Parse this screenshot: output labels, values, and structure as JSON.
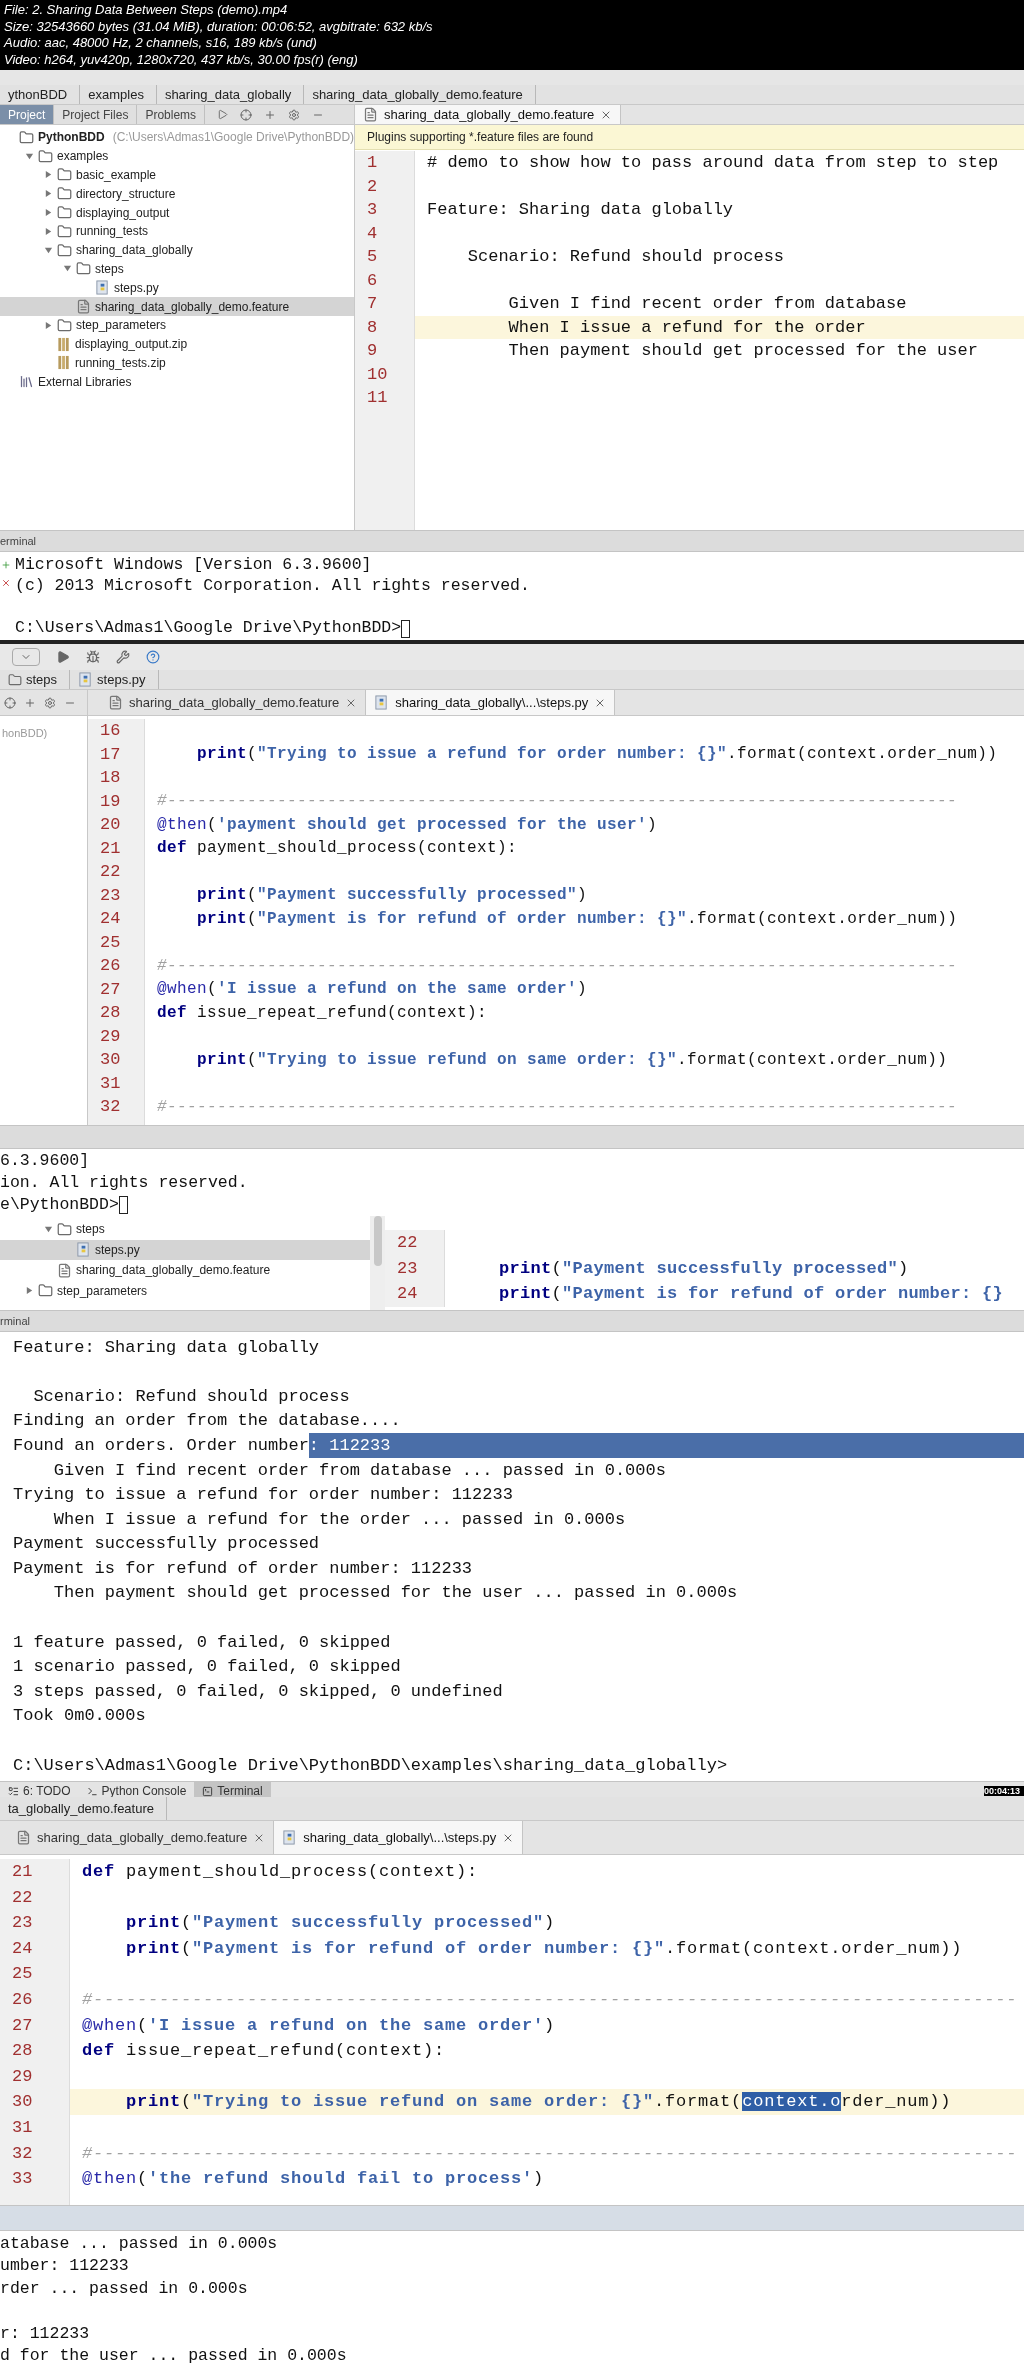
{
  "file_info": [
    "File: 2. Sharing Data Between Steps (demo).mp4",
    "Size: 32543660 bytes (31.04 MiB), duration: 00:06:52, avgbitrate: 632 kb/s",
    "Audio: aac, 48000 Hz, 2 channels, s16, 189 kb/s (und)",
    "Video: h264, yuv420p, 1280x720, 437 kb/s, 30.00 fps(r) (eng)"
  ],
  "frame_1": {
    "breadcrumbs": [
      "ythonBDD",
      "examples",
      "sharing_data_globally",
      "sharing_data_globally_demo.feature"
    ],
    "panel_tabs": [
      {
        "label": "Project",
        "selected": true
      },
      {
        "label": "Project Files",
        "selected": false
      },
      {
        "label": "Problems",
        "selected": false
      }
    ],
    "tree": [
      {
        "label": "PythonBDD",
        "path": "(C:\\Users\\Admas1\\Google Drive\\PythonBDD)",
        "kind": "folder",
        "selected": false,
        "children": [
          {
            "label": "examples",
            "kind": "folder",
            "expanded": true,
            "selected": false,
            "children": [
              {
                "label": "basic_example",
                "kind": "folder",
                "expanded": false,
                "selected": false
              },
              {
                "label": "directory_structure",
                "kind": "folder",
                "expanded": false,
                "selected": false
              },
              {
                "label": "displaying_output",
                "kind": "folder",
                "expanded": false,
                "selected": false
              },
              {
                "label": "running_tests",
                "kind": "folder",
                "expanded": false,
                "selected": false
              },
              {
                "label": "sharing_data_globally",
                "kind": "folder",
                "expanded": true,
                "selected": false,
                "children": [
                  {
                    "label": "steps",
                    "kind": "folder",
                    "expanded": true,
                    "selected": false,
                    "children": [
                      {
                        "label": "steps.py",
                        "kind": "python",
                        "selected": false
                      }
                    ]
                  },
                  {
                    "label": "sharing_data_globally_demo.feature",
                    "kind": "feature",
                    "selected": true
                  }
                ]
              },
              {
                "label": "step_parameters",
                "kind": "folder",
                "expanded": false,
                "selected": false
              },
              {
                "label": "displaying_output.zip",
                "kind": "zip",
                "selected": false
              },
              {
                "label": "running_tests.zip",
                "kind": "zip",
                "selected": false
              }
            ]
          }
        ]
      },
      {
        "label": "External Libraries",
        "kind": "library",
        "selected": false
      }
    ],
    "editor_tabs": [
      {
        "label": "sharing_data_globally_demo.feature",
        "kind": "feature",
        "selected": true
      }
    ],
    "banner": "Plugins supporting *.feature files are found",
    "lines": [
      {
        "number": "1",
        "text": "# demo to show how to pass around data from step to step",
        "current": false
      },
      {
        "number": "2",
        "current": false
      },
      {
        "number": "3",
        "text": "Feature: Sharing data globally",
        "current": false
      },
      {
        "number": "4",
        "current": false
      },
      {
        "number": "5",
        "text": "    Scenario: Refund should process",
        "current": false
      },
      {
        "number": "6",
        "current": false
      },
      {
        "number": "7",
        "text": "        Given I find recent order from database",
        "current": false
      },
      {
        "number": "8",
        "text": "        When I issue a refund for the order",
        "current": true
      },
      {
        "number": "9",
        "text": "        Then payment should get processed for the user",
        "current": false
      },
      {
        "number": "10",
        "current": false
      },
      {
        "number": "11",
        "current": false
      }
    ],
    "terminal": {
      "title": "erminal",
      "lines": [
        {
          "kind": "text",
          "text": "Microsoft Windows [Version 6.3.9600]"
        },
        {
          "kind": "text",
          "text": "(c) 2013 Microsoft Corporation. All rights reserved."
        },
        {
          "kind": "blank"
        },
        {
          "kind": "prompt",
          "text": "C:\\Users\\Admas1\\Google Drive\\PythonBDD>"
        }
      ]
    }
  },
  "frame_2": {
    "breadcrumbs": [
      "steps",
      "steps.py"
    ],
    "project_panel": "honBDD)",
    "editor_tabs": [
      {
        "label": "sharing_data_globally_demo.feature",
        "kind": "feature",
        "selected": false
      },
      {
        "label": "sharing_data_globally\\...\\steps.py",
        "kind": "python",
        "selected": true
      }
    ],
    "lines": [
      {
        "number": "16",
        "current": false
      },
      {
        "number": "17",
        "current": false,
        "segments": [
          {
            "kind": "kw",
            "text": "    print"
          },
          {
            "kind": "plain",
            "text": "("
          },
          {
            "kind": "str",
            "text": "\"Trying to issue a refund for order number: {}\""
          },
          {
            "kind": "plain",
            "text": ".format(context.order_num))"
          }
        ]
      },
      {
        "number": "18",
        "current": false
      },
      {
        "number": "19",
        "current": false,
        "segments": [
          {
            "kind": "cm",
            "text": "#-------------------------------------------------------------------------------"
          }
        ]
      },
      {
        "number": "20",
        "current": false,
        "segments": [
          {
            "kind": "deco",
            "text": "@then"
          },
          {
            "kind": "plain",
            "text": "("
          },
          {
            "kind": "str",
            "text": "'payment should get processed for the user'"
          },
          {
            "kind": "plain",
            "text": ")"
          }
        ]
      },
      {
        "number": "21",
        "current": false,
        "segments": [
          {
            "kind": "kw",
            "text": "def"
          },
          {
            "kind": "plain",
            "text": " payment_should_process(context):"
          }
        ]
      },
      {
        "number": "22",
        "current": false
      },
      {
        "number": "23",
        "current": false,
        "segments": [
          {
            "kind": "kw",
            "text": "    print"
          },
          {
            "kind": "plain",
            "text": "("
          },
          {
            "kind": "str",
            "text": "\"Payment successfully processed\""
          },
          {
            "kind": "plain",
            "text": ")"
          }
        ]
      },
      {
        "number": "24",
        "current": false,
        "segments": [
          {
            "kind": "kw",
            "text": "    print"
          },
          {
            "kind": "plain",
            "text": "("
          },
          {
            "kind": "str",
            "text": "\"Payment is for refund of order number: {}\""
          },
          {
            "kind": "plain",
            "text": ".format(context.order_num))"
          }
        ]
      },
      {
        "number": "25",
        "current": false
      },
      {
        "number": "26",
        "current": false,
        "segments": [
          {
            "kind": "cm",
            "text": "#-------------------------------------------------------------------------------"
          }
        ]
      },
      {
        "number": "27",
        "current": false,
        "segments": [
          {
            "kind": "deco",
            "text": "@when"
          },
          {
            "kind": "plain",
            "text": "("
          },
          {
            "kind": "str",
            "text": "'I issue a refund on the same order'"
          },
          {
            "kind": "plain",
            "text": ")"
          }
        ]
      },
      {
        "number": "28",
        "current": false,
        "segments": [
          {
            "kind": "kw",
            "text": "def"
          },
          {
            "kind": "plain",
            "text": " issue_repeat_refund(context):"
          }
        ]
      },
      {
        "number": "29",
        "current": false
      },
      {
        "number": "30",
        "current": false,
        "segments": [
          {
            "kind": "kw",
            "text": "    print"
          },
          {
            "kind": "plain",
            "text": "("
          },
          {
            "kind": "str",
            "text": "\"Trying to issue refund on same order: {}\""
          },
          {
            "kind": "plain",
            "text": ".format(context.order_num))"
          }
        ]
      },
      {
        "number": "31",
        "current": false
      },
      {
        "number": "32",
        "current": false,
        "segments": [
          {
            "kind": "cm",
            "text": "#-------------------------------------------------------------------------------"
          }
        ]
      }
    ],
    "terminal": {
      "lines": [
        {
          "kind": "text",
          "text": "6.3.9600]"
        },
        {
          "kind": "text",
          "text": "ion. All rights reserved."
        },
        {
          "kind": "prompt",
          "text": "e\\PythonBDD>"
        }
      ]
    }
  },
  "frame_3": {
    "tree": [
      {
        "children": [
          {
            "label": "steps",
            "kind": "folder",
            "expanded": true,
            "selected": false,
            "children": [
              {
                "label": "steps.py",
                "kind": "python",
                "selected": true
              }
            ]
          },
          {
            "label": "sharing_data_globally_demo.feature",
            "kind": "feature",
            "selected": false
          }
        ]
      },
      {
        "label": "step_parameters",
        "kind": "folder",
        "expanded": false,
        "selected": false
      }
    ],
    "lines": [
      {
        "number": "22",
        "current": false
      },
      {
        "number": "23",
        "current": false,
        "segments": [
          {
            "kind": "kw",
            "text": "    print"
          },
          {
            "kind": "plain",
            "text": "("
          },
          {
            "kind": "str",
            "text": "\"Payment successfully processed\""
          },
          {
            "kind": "plain",
            "text": ")"
          }
        ]
      },
      {
        "number": "24",
        "current": false,
        "segments": [
          {
            "kind": "kw",
            "text": "    print"
          },
          {
            "kind": "plain",
            "text": "("
          },
          {
            "kind": "str",
            "text": "\"Payment is for refund of order number: {}"
          }
        ]
      }
    ],
    "terminal": {
      "title": "rminal",
      "lines": [
        {
          "kind": "text",
          "text": "Feature: Sharing data globally"
        },
        {
          "kind": "blank"
        },
        {
          "kind": "text",
          "text": "  Scenario: Refund should process"
        },
        {
          "kind": "text",
          "text": "Finding an order from the database...."
        },
        {
          "kind": "split",
          "segments": [
            {
              "text": "Found an orders. Order number",
              "selected": false
            },
            {
              "text": ": 112233",
              "selected": true
            }
          ]
        },
        {
          "kind": "text",
          "text": "    Given I find recent order from database ... passed in 0.000s"
        },
        {
          "kind": "text",
          "text": "Trying to issue a refund for order number: 112233"
        },
        {
          "kind": "text",
          "text": "    When I issue a refund for the order ... passed in 0.000s"
        },
        {
          "kind": "text",
          "text": "Payment successfully processed"
        },
        {
          "kind": "text",
          "text": "Payment is for refund of order number: 112233"
        },
        {
          "kind": "text",
          "text": "    Then payment should get processed for the user ... passed in 0.000s"
        },
        {
          "kind": "blank"
        },
        {
          "kind": "text",
          "text": "1 feature passed, 0 failed, 0 skipped"
        },
        {
          "kind": "text",
          "text": "1 scenario passed, 0 failed, 0 skipped"
        },
        {
          "kind": "text",
          "text": "3 steps passed, 0 failed, 0 skipped, 0 undefined"
        },
        {
          "kind": "text",
          "text": "Took 0m0.000s"
        },
        {
          "kind": "blank"
        },
        {
          "kind": "text",
          "text": "C:\\Users\\Admas1\\Google Drive\\PythonBDD\\examples\\sharing_data_globally>"
        }
      ]
    },
    "tool_tabs": [
      {
        "label": "6: TODO",
        "kind": "todo",
        "selected": false
      },
      {
        "label": "Python Console",
        "kind": "console",
        "selected": false
      },
      {
        "label": "Terminal",
        "kind": "terminal",
        "selected": true
      }
    ],
    "timestamp": "00:04:13"
  },
  "frame_4": {
    "breadcrumbs": [
      "ta_globally_demo.feature"
    ],
    "editor_tabs": [
      {
        "label": "sharing_data_globally_demo.feature",
        "kind": "feature",
        "selected": false
      },
      {
        "label": "sharing_data_globally\\...\\steps.py",
        "kind": "python",
        "selected": true
      }
    ],
    "lines": [
      {
        "number": "21",
        "current": false,
        "segments": [
          {
            "kind": "kw",
            "text": "def"
          },
          {
            "kind": "plain",
            "text": " payment_should_process(context):"
          }
        ]
      },
      {
        "number": "22",
        "current": false
      },
      {
        "number": "23",
        "current": false,
        "segments": [
          {
            "kind": "kw",
            "text": "    print"
          },
          {
            "kind": "plain",
            "text": "("
          },
          {
            "kind": "str",
            "text": "\"Payment successfully processed\""
          },
          {
            "kind": "plain",
            "text": ")"
          }
        ]
      },
      {
        "number": "24",
        "current": false,
        "segments": [
          {
            "kind": "kw",
            "text": "    print"
          },
          {
            "kind": "plain",
            "text": "("
          },
          {
            "kind": "str",
            "text": "\"Payment is for refund of order number: {}\""
          },
          {
            "kind": "plain",
            "text": ".format(context.order_num))"
          }
        ]
      },
      {
        "number": "25",
        "current": false
      },
      {
        "number": "26",
        "current": false,
        "segments": [
          {
            "kind": "cm",
            "text": "#------------------------------------------------------------------------------------"
          }
        ]
      },
      {
        "number": "27",
        "current": false,
        "segments": [
          {
            "kind": "deco",
            "text": "@when"
          },
          {
            "kind": "plain",
            "text": "("
          },
          {
            "kind": "str",
            "text": "'I issue a refund on the same order'"
          },
          {
            "kind": "plain",
            "text": ")"
          }
        ]
      },
      {
        "number": "28",
        "current": false,
        "segments": [
          {
            "kind": "kw",
            "text": "def"
          },
          {
            "kind": "plain",
            "text": " issue_repeat_refund(context):"
          }
        ]
      },
      {
        "number": "29",
        "current": false
      },
      {
        "number": "30",
        "current": true,
        "segments": [
          {
            "kind": "kw",
            "text": "    print",
            "selected": false
          },
          {
            "kind": "plain",
            "text": "(",
            "selected": false
          },
          {
            "kind": "str",
            "text": "\"Trying to issue refund on same order: {}\"",
            "selected": false
          },
          {
            "kind": "plain",
            "text": ".format(",
            "selected": false
          },
          {
            "kind": "plain",
            "text": "context.o",
            "selected": true
          },
          {
            "kind": "plain",
            "text": "rder_num))",
            "selected": false
          }
        ]
      },
      {
        "number": "31",
        "current": false
      },
      {
        "number": "32",
        "current": false,
        "segments": [
          {
            "kind": "cm",
            "text": "#------------------------------------------------------------------------------------"
          }
        ]
      },
      {
        "number": "33",
        "current": false,
        "segments": [
          {
            "kind": "deco",
            "text": "@then"
          },
          {
            "kind": "plain",
            "text": "("
          },
          {
            "kind": "str",
            "text": "'the refund should fail to process'"
          },
          {
            "kind": "plain",
            "text": ")"
          }
        ]
      }
    ],
    "terminal": {
      "lines": [
        {
          "kind": "text",
          "text": "atabase ... passed in 0.000s"
        },
        {
          "kind": "text",
          "text": "umber: 112233"
        },
        {
          "kind": "text",
          "text": "rder ... passed in 0.000s"
        },
        {
          "kind": "blank"
        },
        {
          "kind": "text",
          "text": "r: 112233"
        },
        {
          "kind": "text",
          "text": "d for the user ... passed in 0.000s"
        }
      ]
    }
  }
}
